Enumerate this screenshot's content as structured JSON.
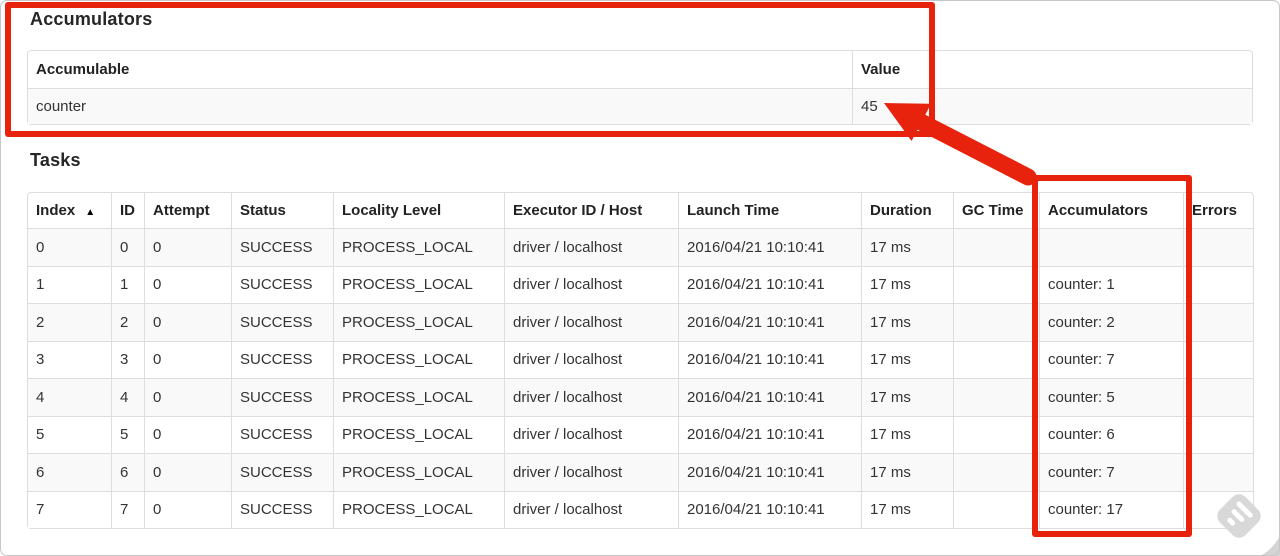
{
  "annotation": {
    "color": "#e8230d"
  },
  "accumulators_section": {
    "title": "Accumulators",
    "table": {
      "headers": [
        "Accumulable",
        "Value"
      ],
      "rows": [
        {
          "accumulable": "counter",
          "value": "45"
        }
      ]
    }
  },
  "tasks_section": {
    "title": "Tasks",
    "table": {
      "headers": [
        "Index",
        "ID",
        "Attempt",
        "Status",
        "Locality Level",
        "Executor ID / Host",
        "Launch Time",
        "Duration",
        "GC Time",
        "Accumulators",
        "Errors"
      ],
      "sort_column": "Index",
      "sort_indicator": "▲",
      "rows": [
        {
          "index": "0",
          "id": "0",
          "attempt": "0",
          "status": "SUCCESS",
          "locality_level": "PROCESS_LOCAL",
          "executor_id_host": "driver / localhost",
          "launch_time": "2016/04/21 10:10:41",
          "duration": "17 ms",
          "gc_time": "",
          "accumulators": "",
          "errors": ""
        },
        {
          "index": "1",
          "id": "1",
          "attempt": "0",
          "status": "SUCCESS",
          "locality_level": "PROCESS_LOCAL",
          "executor_id_host": "driver / localhost",
          "launch_time": "2016/04/21 10:10:41",
          "duration": "17 ms",
          "gc_time": "",
          "accumulators": "counter: 1",
          "errors": ""
        },
        {
          "index": "2",
          "id": "2",
          "attempt": "0",
          "status": "SUCCESS",
          "locality_level": "PROCESS_LOCAL",
          "executor_id_host": "driver / localhost",
          "launch_time": "2016/04/21 10:10:41",
          "duration": "17 ms",
          "gc_time": "",
          "accumulators": "counter: 2",
          "errors": ""
        },
        {
          "index": "3",
          "id": "3",
          "attempt": "0",
          "status": "SUCCESS",
          "locality_level": "PROCESS_LOCAL",
          "executor_id_host": "driver / localhost",
          "launch_time": "2016/04/21 10:10:41",
          "duration": "17 ms",
          "gc_time": "",
          "accumulators": "counter: 7",
          "errors": ""
        },
        {
          "index": "4",
          "id": "4",
          "attempt": "0",
          "status": "SUCCESS",
          "locality_level": "PROCESS_LOCAL",
          "executor_id_host": "driver / localhost",
          "launch_time": "2016/04/21 10:10:41",
          "duration": "17 ms",
          "gc_time": "",
          "accumulators": "counter: 5",
          "errors": ""
        },
        {
          "index": "5",
          "id": "5",
          "attempt": "0",
          "status": "SUCCESS",
          "locality_level": "PROCESS_LOCAL",
          "executor_id_host": "driver / localhost",
          "launch_time": "2016/04/21 10:10:41",
          "duration": "17 ms",
          "gc_time": "",
          "accumulators": "counter: 6",
          "errors": ""
        },
        {
          "index": "6",
          "id": "6",
          "attempt": "0",
          "status": "SUCCESS",
          "locality_level": "PROCESS_LOCAL",
          "executor_id_host": "driver / localhost",
          "launch_time": "2016/04/21 10:10:41",
          "duration": "17 ms",
          "gc_time": "",
          "accumulators": "counter: 7",
          "errors": ""
        },
        {
          "index": "7",
          "id": "7",
          "attempt": "0",
          "status": "SUCCESS",
          "locality_level": "PROCESS_LOCAL",
          "executor_id_host": "driver / localhost",
          "launch_time": "2016/04/21 10:10:41",
          "duration": "17 ms",
          "gc_time": "",
          "accumulators": "counter: 17",
          "errors": ""
        }
      ]
    }
  },
  "annotations_meta": {
    "rect_1": "highlights-accumulators-section",
    "rect_2": "highlights-accumulators-task-column",
    "arrow": "points-from-task-column-to-total-value-45"
  },
  "watermark": {
    "icon": "annotation-tool-diamond-logo"
  }
}
